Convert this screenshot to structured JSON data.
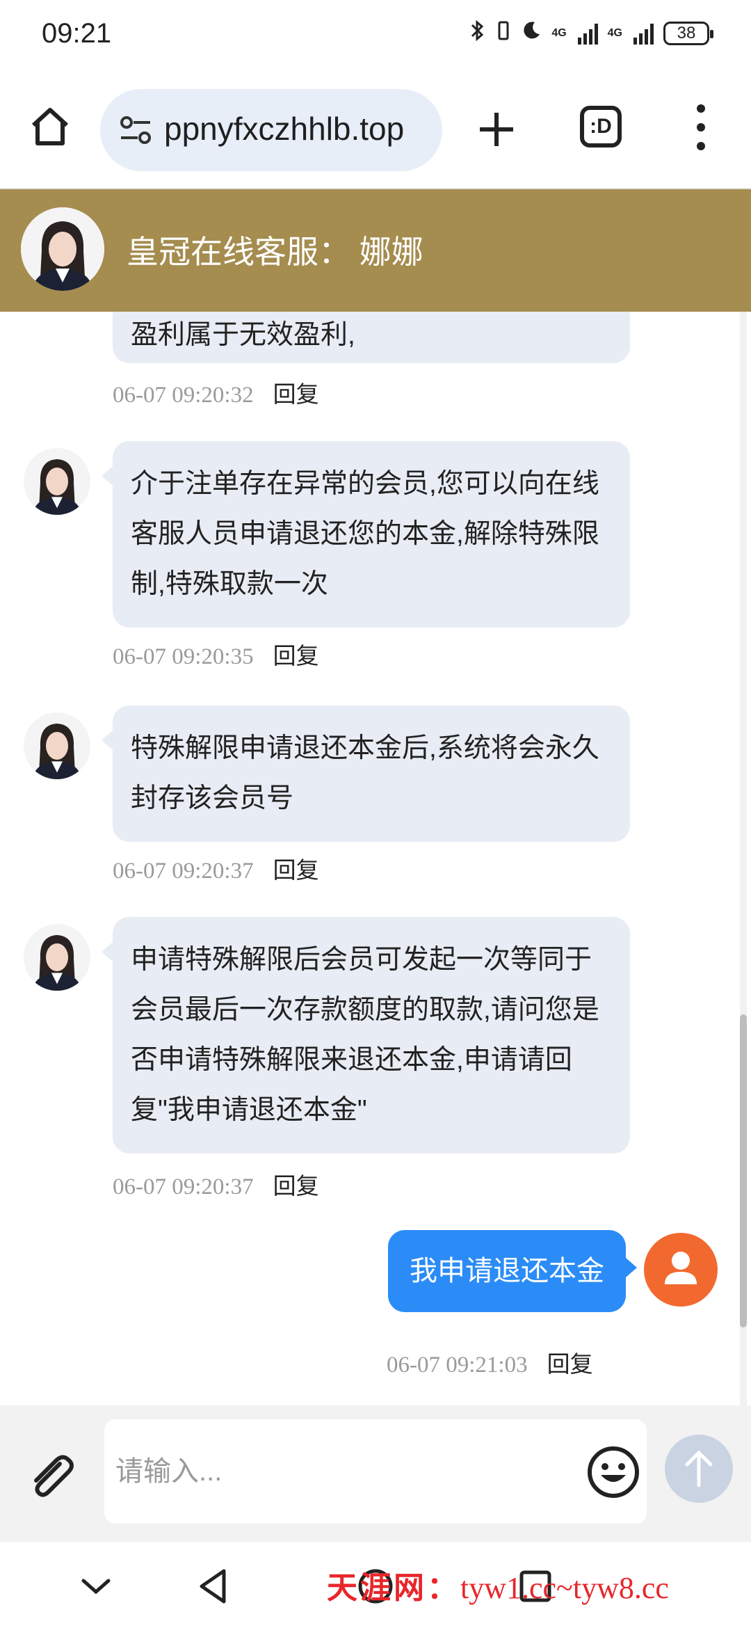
{
  "status_bar": {
    "time": "09:21",
    "battery": "38",
    "network1": "4G",
    "network2": "4G"
  },
  "browser": {
    "url": "ppnyfxczhhlb.top",
    "tabs_label": ":D",
    "icons": [
      "home-icon",
      "site-settings-icon",
      "plus-icon",
      "tabs-icon",
      "more-vert-icon"
    ]
  },
  "header": {
    "title": "皇冠在线客服：  娜娜",
    "avatar_icon": "agent-avatar"
  },
  "messages": [
    {
      "text": "盈利属于无效盈利,",
      "time": "06-07 09:20:32",
      "reply": "回复"
    },
    {
      "text": "介于注单存在异常的会员,您可以向在线客服人员申请退还您的本金,解除特殊限制,特殊取款一次",
      "time": "06-07 09:20:35",
      "reply": "回复"
    },
    {
      "text": "特殊解限申请退还本金后,系统将会永久封存该会员号",
      "time": "06-07 09:20:37",
      "reply": "回复"
    },
    {
      "text": "申请特殊解限后会员可发起一次等同于会员最后一次存款额度的取款,请问您是否申请特殊解限来退还本金,申请请回复\"我申请退还本金\"",
      "time": "06-07 09:20:37",
      "reply": "回复"
    }
  ],
  "self_message": {
    "text": "我申请退还本金",
    "time": "06-07 09:21:03",
    "reply": "回复"
  },
  "input": {
    "placeholder": "请输入...",
    "value": ""
  },
  "watermark": {
    "brand": "天涯网：",
    "urls": "tyw1.cc~tyw8.cc"
  },
  "colors": {
    "header_bg": "#a58c4f",
    "self_bubble": "#2b8cf7",
    "agent_bubble": "#e8ecf4",
    "self_avatar": "#f2692f",
    "watermark": "#e8262a"
  }
}
